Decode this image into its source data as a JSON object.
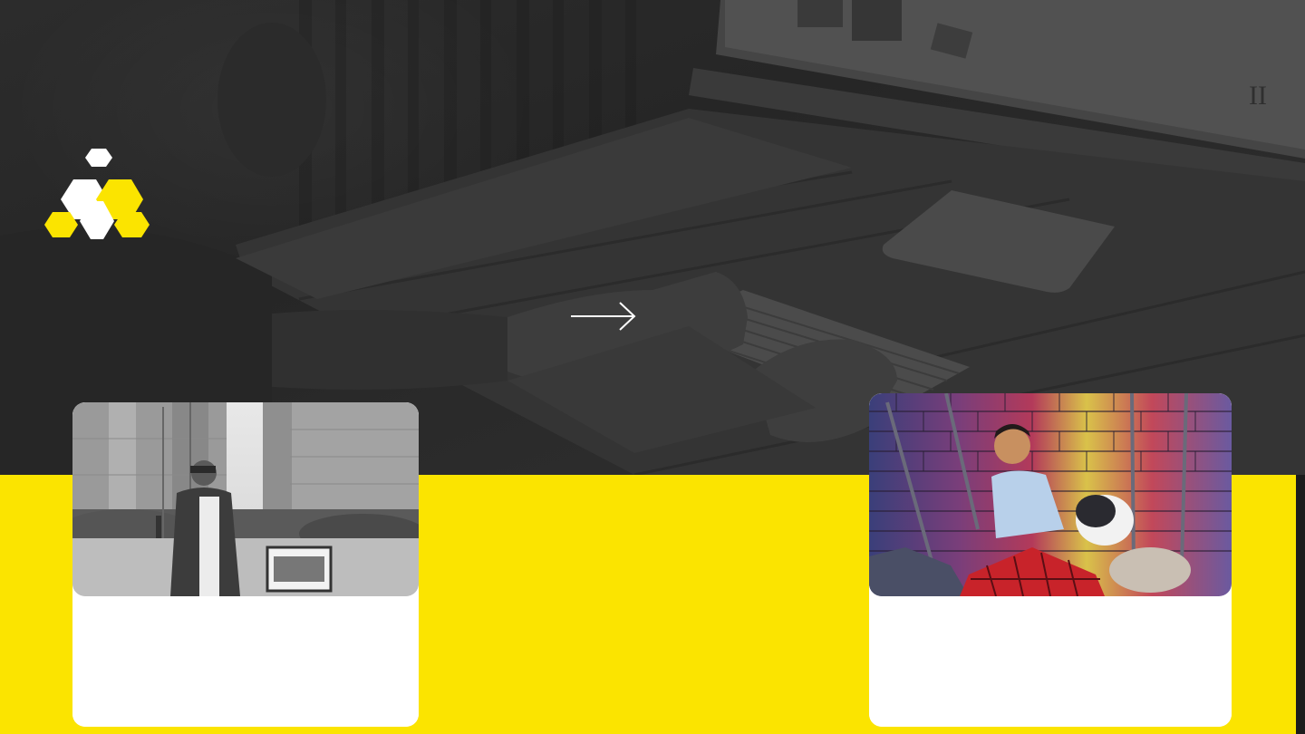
{
  "page": {
    "title": ""
  },
  "colors": {
    "accent_yellow": "#fbe400",
    "hero_dark": "#2a2a2a",
    "card_white": "#ffffff",
    "logo_white": "#ffffff",
    "logo_yellow": "#fbe400"
  },
  "icons": {
    "logo": "hexagon-logo-icon",
    "arrow": "arrow-right-icon"
  },
  "hero": {
    "background_image": "desk-laptop-photo",
    "next_label": ""
  },
  "cards": [
    {
      "image": "man-standing-grayscale-photo",
      "text": ""
    },
    {
      "image": "boy-with-dog-brick-wall-photo",
      "text": ""
    }
  ]
}
